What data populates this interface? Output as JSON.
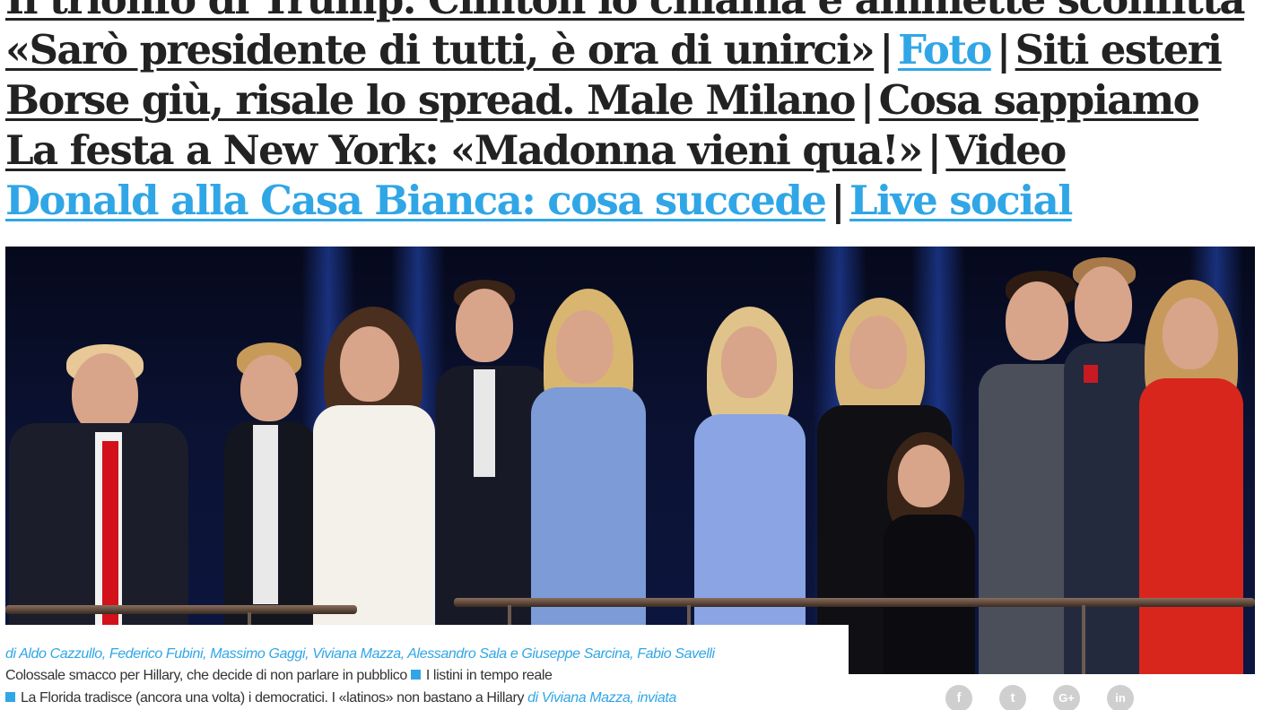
{
  "headlines": {
    "line0": {
      "text": "Il trionfo di Trump. Clinton lo chiama e ammette sconfitta"
    },
    "line1": {
      "text": "«Sarò presidente di tutti, è ora di unirci»",
      "separator": "|",
      "link1": "Foto",
      "link2": "Siti esteri"
    },
    "line2": {
      "text": "Borse giù, risale lo spread. Male Milano",
      "separator": "|",
      "link1": "Cosa sappiamo"
    },
    "line3": {
      "text": "La festa a New York: «Madonna vieni qua!»",
      "separator": "|",
      "link1": "Video"
    },
    "line4": {
      "text": "Donald alla Casa Bianca: cosa succede",
      "separator": "|",
      "link1": "Live social"
    }
  },
  "caption": {
    "authors": "di Aldo Cazzullo, Federico Fubini, Massimo Gaggi, Viviana Mazza, Alessandro Sala e Giuseppe Sarcina, Fabio Savelli",
    "line2_text": "Colossale smacco per Hillary, che decide di non parlare in pubblico",
    "line2_link": "I listini in tempo reale",
    "line3_text": "La Florida tradisce (ancora una volta) i democratici. I «latinos» non bastano a Hillary",
    "line3_author": "di Viviana Mazza, inviata"
  },
  "share": {
    "facebook": "f",
    "twitter": "t",
    "googleplus": "G+",
    "linkedin": "in"
  },
  "colors": {
    "text": "#222222",
    "link_blue": "#30a6e6",
    "icon_gray": "#cfcfcf"
  }
}
